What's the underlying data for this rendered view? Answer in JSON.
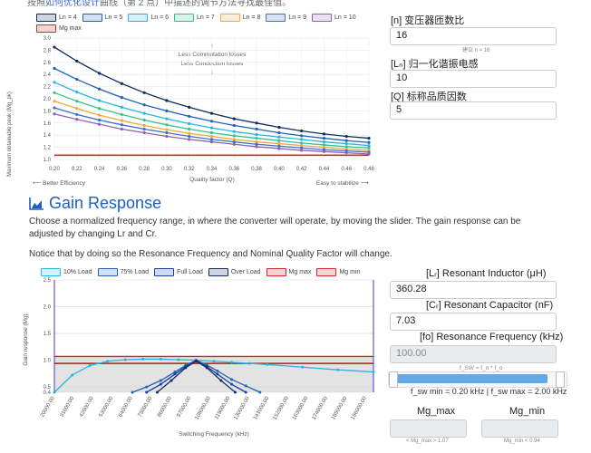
{
  "top_text": {
    "prefix": "按照",
    "link": "如何优化设计",
    "suffix": "曲线（第 2 点）中描述的调节方法寻找最佳值。"
  },
  "chart1": {
    "legend": [
      {
        "name": "Ln = 4",
        "color": "#0f2d5f"
      },
      {
        "name": "Ln = 5",
        "color": "#1e63b8"
      },
      {
        "name": "Ln = 6",
        "color": "#28b5e0"
      },
      {
        "name": "Ln = 7",
        "color": "#2fc48b"
      },
      {
        "name": "Ln = 8",
        "color": "#f2a93b"
      },
      {
        "name": "Ln = 9",
        "color": "#3c6fd1"
      },
      {
        "name": "Ln = 10",
        "color": "#8a63b8"
      },
      {
        "name": "Mg max",
        "color": "#d62728"
      }
    ],
    "annotation_up": "Less Commutation losses",
    "annotation_down": "Less Conduction losses",
    "left_note": "⟵ Better Efficiency",
    "right_note": "Easy to stabilize ⟶",
    "xlabel": "Quality factor (Q)",
    "ylabel": "Maximum obtainable peak (Mg_pk)"
  },
  "right_panel": {
    "n_label": "[n] 变压器匝数比",
    "n_value": "16",
    "n_hint": "建议 n = 16",
    "ln_label": "[Lₙ] 归一化谐振电感",
    "ln_value": "10",
    "q_label": "[Q] 标称品质因数",
    "q_value": "5",
    "lr_label": "[Lᵣ] Resonant Inductor (μH)",
    "lr_value": "360.28",
    "cr_label": "[Cᵣ] Resonant Capacitor (nF)",
    "cr_value": "7.03",
    "fo_label": "[fo] Resonance Frequency (kHz)",
    "fo_value": "100.00",
    "fsw_formula": "f_SW = f_n * f_o",
    "fsw_range": "f_sw min = 0.20 kHz | f_sw max = 2.00 kHz",
    "mgmax_label": "Mg_max",
    "mgmax_hint": "< Mg_max > 1.07",
    "mgmin_label": "Mg_min",
    "mgmin_hint": "Mg_min < 0.94"
  },
  "gain": {
    "title": "Gain Response",
    "icon": "area-chart-icon",
    "para1": "Choose a normalized frequency range, in where the converter will operate, by moving the slider. The gain response can be adjusted by changing Lr and Cr.",
    "para2": "Notice that by doing so the Resonance Frequency and Nominal Quality Factor will change.",
    "legend": [
      {
        "name": "10% Load",
        "color": "#28b5e0"
      },
      {
        "name": "75% Load",
        "color": "#1e63b8"
      },
      {
        "name": "Full Load",
        "color": "#1a3fa8"
      },
      {
        "name": "Over Load",
        "color": "#0f2d5f"
      },
      {
        "name": "Mg max",
        "color": "#d62728"
      },
      {
        "name": "Mg min",
        "color": "#d62728"
      }
    ],
    "xlabel": "Switching Frequency (kHz)",
    "ylabel": "Gain response (Mg)"
  },
  "chart_data": [
    {
      "type": "line",
      "x": [
        0.2,
        0.22,
        0.24,
        0.26,
        0.28,
        0.3,
        0.32,
        0.34,
        0.36,
        0.38,
        0.4,
        0.42,
        0.44,
        0.46,
        0.48
      ],
      "xlim": [
        0.2,
        0.48
      ],
      "ylim": [
        1.0,
        3.0
      ],
      "yticks": [
        1.0,
        1.2,
        1.4,
        1.6,
        1.8,
        2.0,
        2.2,
        2.4,
        2.6,
        2.8,
        3.0
      ],
      "xticks": [
        "0.20",
        "0.22",
        "0.24",
        "0.26",
        "0.28",
        "0.30",
        "0.32",
        "0.34",
        "0.36",
        "0.38",
        "0.40",
        "0.42",
        "0.44",
        "0.46",
        "0.48"
      ],
      "mg_max": 1.07,
      "series": [
        {
          "name": "Ln = 4",
          "color": "#0f2d5f",
          "values": [
            2.85,
            2.62,
            2.42,
            2.25,
            2.1,
            1.97,
            1.86,
            1.76,
            1.67,
            1.6,
            1.53,
            1.47,
            1.42,
            1.38,
            1.35
          ]
        },
        {
          "name": "Ln = 5",
          "color": "#1e63b8",
          "values": [
            2.5,
            2.32,
            2.16,
            2.02,
            1.9,
            1.8,
            1.71,
            1.63,
            1.56,
            1.5,
            1.44,
            1.39,
            1.35,
            1.31,
            1.28
          ]
        },
        {
          "name": "Ln = 6",
          "color": "#28b5e0",
          "values": [
            2.27,
            2.11,
            1.97,
            1.86,
            1.76,
            1.67,
            1.59,
            1.52,
            1.46,
            1.41,
            1.37,
            1.33,
            1.29,
            1.26,
            1.23
          ]
        },
        {
          "name": "Ln = 7",
          "color": "#2fc48b",
          "values": [
            2.1,
            1.96,
            1.84,
            1.74,
            1.65,
            1.57,
            1.5,
            1.44,
            1.39,
            1.35,
            1.31,
            1.27,
            1.24,
            1.21,
            1.19
          ]
        },
        {
          "name": "Ln = 8",
          "color": "#f2a93b",
          "values": [
            1.96,
            1.84,
            1.73,
            1.64,
            1.56,
            1.49,
            1.43,
            1.38,
            1.33,
            1.29,
            1.26,
            1.23,
            1.2,
            1.17,
            1.15
          ]
        },
        {
          "name": "Ln = 9",
          "color": "#3c6fd1",
          "values": [
            1.85,
            1.74,
            1.65,
            1.57,
            1.5,
            1.44,
            1.38,
            1.33,
            1.29,
            1.25,
            1.22,
            1.19,
            1.16,
            1.14,
            1.12
          ]
        },
        {
          "name": "Ln = 10",
          "color": "#8a63b8",
          "values": [
            1.75,
            1.66,
            1.58,
            1.5,
            1.44,
            1.38,
            1.33,
            1.29,
            1.25,
            1.21,
            1.18,
            1.15,
            1.13,
            1.11,
            1.09
          ]
        }
      ]
    },
    {
      "type": "line",
      "xticks": [
        "20000.00",
        "31000.00",
        "42000.00",
        "53000.00",
        "64000.00",
        "75000.00",
        "86000.00",
        "97000.00",
        "108000.00",
        "119000.00",
        "130000.00",
        "141000.00",
        "152000.00",
        "163000.00",
        "174000.00",
        "185000.00",
        "196000.00"
      ],
      "ylim": [
        0.4,
        2.5
      ],
      "yticks": [
        0.4,
        0.5,
        1.0,
        1.5,
        2.0,
        2.5
      ],
      "mg_max": 1.07,
      "mg_min": 0.94,
      "series": [
        {
          "name": "10% Load",
          "color": "#28b5e0",
          "x": [
            20000,
            30000,
            40000,
            50000,
            60000,
            70000,
            80000,
            90000,
            100000,
            110000,
            120000,
            130000,
            140000,
            160000,
            180000,
            200000
          ],
          "values": [
            0.4,
            0.72,
            0.9,
            0.98,
            1.01,
            1.02,
            1.02,
            1.01,
            1.0,
            0.98,
            0.96,
            0.94,
            0.92,
            0.87,
            0.82,
            0.78
          ]
        },
        {
          "name": "75% Load",
          "color": "#1e63b8",
          "x": [
            64000,
            72000,
            80000,
            88000,
            94000,
            100000,
            106000,
            112000,
            120000,
            128000,
            136000
          ],
          "values": [
            0.4,
            0.5,
            0.62,
            0.78,
            0.9,
            1.0,
            0.91,
            0.8,
            0.64,
            0.52,
            0.4
          ]
        },
        {
          "name": "Full Load",
          "color": "#1a3fa8",
          "x": [
            72000,
            80000,
            88000,
            94000,
            100000,
            106000,
            112000,
            120000,
            128000
          ],
          "values": [
            0.4,
            0.55,
            0.74,
            0.88,
            0.99,
            0.88,
            0.74,
            0.55,
            0.4
          ]
        },
        {
          "name": "Over Load",
          "color": "#0f2d5f",
          "x": [
            78000,
            86000,
            94000,
            100000,
            106000,
            114000,
            122000
          ],
          "values": [
            0.4,
            0.62,
            0.86,
            0.98,
            0.86,
            0.62,
            0.4
          ]
        }
      ]
    }
  ]
}
